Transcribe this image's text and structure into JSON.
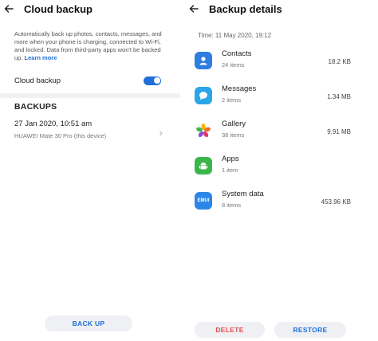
{
  "left": {
    "title": "Cloud backup",
    "description": "Automatically back up photos, contacts, messages, and more when your phone is charging, connected to Wi-Fi, and locked. Data from third-party apps won't be backed up.",
    "learn_more": "Learn more",
    "toggle_label": "Cloud backup",
    "toggle_on": true,
    "section_title": "BACKUPS",
    "backup_item": {
      "date": "27 Jan 2020, 10:51 am",
      "device": "HUAWEI Mate 30 Pro (this device)"
    },
    "backup_button": "BACK UP"
  },
  "right": {
    "title": "Backup details",
    "time": "Time: 11 May 2020, 19:12",
    "items": [
      {
        "name": "Contacts",
        "count": "24 items",
        "size": "18.2 KB",
        "icon": "contacts-icon"
      },
      {
        "name": "Messages",
        "count": "2 items",
        "size": "1.34 MB",
        "icon": "messages-icon"
      },
      {
        "name": "Gallery",
        "count": "38 items",
        "size": "9.91 MB",
        "icon": "gallery-icon"
      },
      {
        "name": "Apps",
        "count": "1 item",
        "size": "",
        "icon": "apps-icon"
      },
      {
        "name": "System data",
        "count": "8 items",
        "size": "453.96 KB",
        "icon": "emui-icon",
        "icon_text": "EMUI"
      }
    ],
    "delete_button": "DELETE",
    "restore_button": "RESTORE"
  },
  "colors": {
    "accent": "#1e6fd9",
    "danger": "#e34c4c",
    "contacts": "#2f7de1",
    "messages": "#2aa6e8",
    "apps": "#3ab54a",
    "emui": "#2a86e8"
  }
}
